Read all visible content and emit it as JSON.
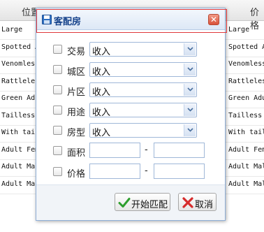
{
  "background": {
    "headers": [
      "位置",
      "价格"
    ],
    "rows": [
      {
        "left": "Large",
        "right": "Large"
      },
      {
        "left": "Spotted A",
        "right": "Spotted A"
      },
      {
        "left": "Venomless",
        "right": "Venomless"
      },
      {
        "left": "Rattleles",
        "right": "Rattleles"
      },
      {
        "left": "Green Adu",
        "right": "Green Adu"
      },
      {
        "left": "Tailless",
        "right": "Tailless"
      },
      {
        "left": "With tail",
        "right": "With tail"
      },
      {
        "left": "Adult Fem",
        "right": "Adult Fem"
      },
      {
        "left": "Adult Mal",
        "right": "Adult Mal"
      },
      {
        "left": "Adult Mal",
        "right": "Adult Mal"
      }
    ]
  },
  "dialog": {
    "title": "客配房",
    "close_symbol": "✕",
    "fields": [
      {
        "label": "交易",
        "value": "收入"
      },
      {
        "label": "城区",
        "value": "收入"
      },
      {
        "label": "片区",
        "value": "收入"
      },
      {
        "label": "用途",
        "value": "收入"
      },
      {
        "label": "房型",
        "value": "收入"
      }
    ],
    "ranges": [
      {
        "label": "面积",
        "separator": "-"
      },
      {
        "label": "价格",
        "separator": "-"
      }
    ],
    "buttons": {
      "match": "开始匹配",
      "cancel": "取消"
    }
  },
  "colors": {
    "title_text": "#15428b",
    "highlight_border": "#e0393c",
    "check_icon": "#2e9e2e",
    "cancel_icon": "#d62b2b"
  }
}
